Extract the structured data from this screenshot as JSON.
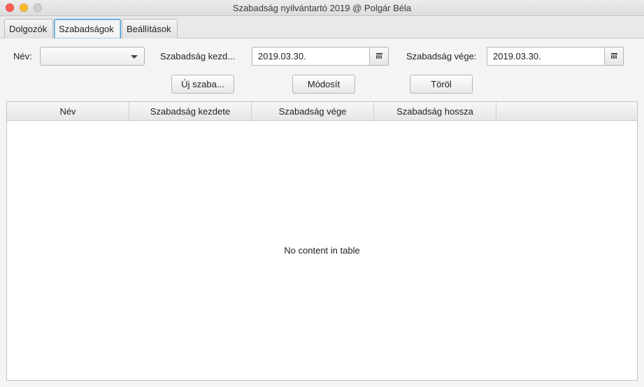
{
  "window": {
    "title": "Szabadság nyilvántartó 2019 @ Polgár Béla"
  },
  "tabs": [
    {
      "label": "Dolgozók"
    },
    {
      "label": "Szabadságok"
    },
    {
      "label": "Beállítások"
    }
  ],
  "active_tab": "Szabadságok",
  "form": {
    "name_label": "Név:",
    "name_value": "",
    "start_label": "Szabadság kezd...",
    "start_value": "2019.03.30.",
    "end_label": "Szabadság vége:",
    "end_value": "2019.03.30."
  },
  "buttons": {
    "new": "Új szaba...",
    "modify": "Módosít",
    "delete": "Töröl"
  },
  "table": {
    "columns": [
      "Név",
      "Szabadság kezdete",
      "Szabadság vége",
      "Szabadság hossza"
    ],
    "rows": [],
    "empty_text": "No content in table"
  },
  "icons": {
    "calendar": "calendar-icon",
    "dropdown": "chevron-down-icon"
  }
}
